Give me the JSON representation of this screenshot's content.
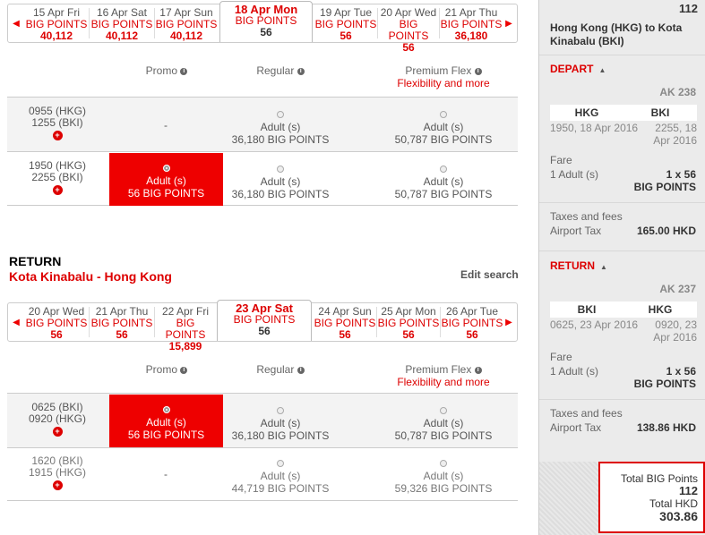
{
  "depart": {
    "dates": [
      {
        "date": "15 Apr Fri",
        "label": "BIG POINTS",
        "value": "40,112"
      },
      {
        "date": "16 Apr Sat",
        "label": "BIG POINTS",
        "value": "40,112"
      },
      {
        "date": "17 Apr Sun",
        "label": "BIG POINTS",
        "value": "40,112"
      },
      {
        "date": "18 Apr Mon",
        "label": "BIG POINTS",
        "value": "56"
      },
      {
        "date": "19 Apr Tue",
        "label": "BIG POINTS",
        "value": "56"
      },
      {
        "date": "20 Apr Wed",
        "label": "BIG POINTS",
        "value": "56"
      },
      {
        "date": "21 Apr Thu",
        "label": "BIG POINTS",
        "value": "36,180"
      }
    ],
    "headers": {
      "promo": "Promo",
      "regular": "Regular",
      "premium": "Premium Flex",
      "flex": "Flexibility and more"
    },
    "flights": [
      {
        "dep": "0955 (HKG)",
        "arr": "1255 (BKI)",
        "promo": "-",
        "regular_label": "Adult (s)",
        "regular": "36,180 BIG POINTS",
        "premium_label": "Adult (s)",
        "premium": "50,787 BIG POINTS"
      },
      {
        "dep": "1950 (HKG)",
        "arr": "2255 (BKI)",
        "promo_label": "Adult (s)",
        "promo": "56 BIG POINTS",
        "regular_label": "Adult (s)",
        "regular": "36,180 BIG POINTS",
        "premium_label": "Adult (s)",
        "premium": "50,787 BIG POINTS"
      }
    ]
  },
  "return": {
    "title": "RETURN",
    "route": "Kota Kinabalu - Hong Kong",
    "edit": "Edit search",
    "dates": [
      {
        "date": "20 Apr Wed",
        "label": "BIG POINTS",
        "value": "56"
      },
      {
        "date": "21 Apr Thu",
        "label": "BIG POINTS",
        "value": "56"
      },
      {
        "date": "22 Apr Fri",
        "label": "BIG POINTS",
        "value": "15,899"
      },
      {
        "date": "23 Apr Sat",
        "label": "BIG POINTS",
        "value": "56"
      },
      {
        "date": "24 Apr Sun",
        "label": "BIG POINTS",
        "value": "56"
      },
      {
        "date": "25 Apr Mon",
        "label": "BIG POINTS",
        "value": "56"
      },
      {
        "date": "26 Apr Tue",
        "label": "BIG POINTS",
        "value": "56"
      }
    ],
    "headers": {
      "promo": "Promo",
      "regular": "Regular",
      "premium": "Premium Flex",
      "flex": "Flexibility and more"
    },
    "flights": [
      {
        "dep": "0625 (BKI)",
        "arr": "0920 (HKG)",
        "promo_label": "Adult (s)",
        "promo": "56 BIG POINTS",
        "regular_label": "Adult (s)",
        "regular": "36,180 BIG POINTS",
        "premium_label": "Adult (s)",
        "premium": "50,787 BIG POINTS"
      },
      {
        "dep": "1620 (BKI)",
        "arr": "1915 (HKG)",
        "promo": "-",
        "regular_label": "Adult (s)",
        "regular": "44,719 BIG POINTS",
        "premium_label": "Adult (s)",
        "premium": "59,326 BIG POINTS"
      }
    ]
  },
  "summary": {
    "top_total": "112",
    "route": "Hong Kong (HKG) to Kota Kinabalu (BKI)",
    "depart": {
      "title": "DEPART",
      "flight_no": "AK 238",
      "from": "HKG",
      "to": "BKI",
      "dep_time": "1950, 18 Apr 2016",
      "arr_time": "2255, 18 Apr 2016",
      "fare_label": "Fare",
      "pax": "1 Adult (s)",
      "fare_value": "1 x 56",
      "fare_unit": "BIG POINTS",
      "tax_label": "Taxes and fees",
      "tax_name": "Airport Tax",
      "tax_value": "165.00 HKD"
    },
    "return": {
      "title": "RETURN",
      "flight_no": "AK 237",
      "from": "BKI",
      "to": "HKG",
      "dep_time": "0625, 23 Apr 2016",
      "arr_time": "0920, 23 Apr 2016",
      "fare_label": "Fare",
      "pax": "1 Adult (s)",
      "fare_value": "1 x 56",
      "fare_unit": "BIG POINTS",
      "tax_label": "Taxes and fees",
      "tax_name": "Airport Tax",
      "tax_value": "138.86 HKD"
    },
    "total_points_label": "Total BIG Points",
    "total_points": "112",
    "total_hkd_label": "Total HKD",
    "total_hkd": "303.86"
  }
}
